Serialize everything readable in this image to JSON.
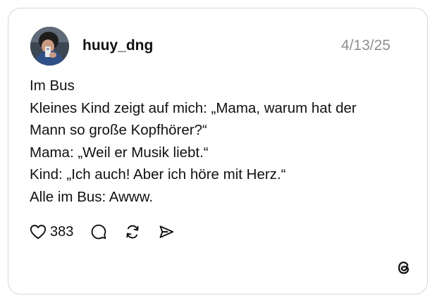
{
  "post": {
    "username": "huuy_dng",
    "date": "4/13/25",
    "lines": [
      "Im Bus",
      "Kleines Kind zeigt auf mich: „Mama, warum hat der",
      "Mann so große Kopfhörer?“",
      "Mama: „Weil er Musik liebt.“",
      "Kind: „Ich auch! Aber ich höre mit Herz.“",
      "Alle im Bus: Awww."
    ]
  },
  "actions": {
    "like_icon": "heart-icon",
    "like_count": "383",
    "comment_icon": "comment-bubble-icon",
    "repost_icon": "repost-icon",
    "share_icon": "send-icon"
  },
  "branding": {
    "logo": "threads-logo-icon"
  },
  "colors": {
    "text": "#111111",
    "muted": "#8f8f8f",
    "border": "#d6d6d6",
    "background": "#ffffff"
  }
}
